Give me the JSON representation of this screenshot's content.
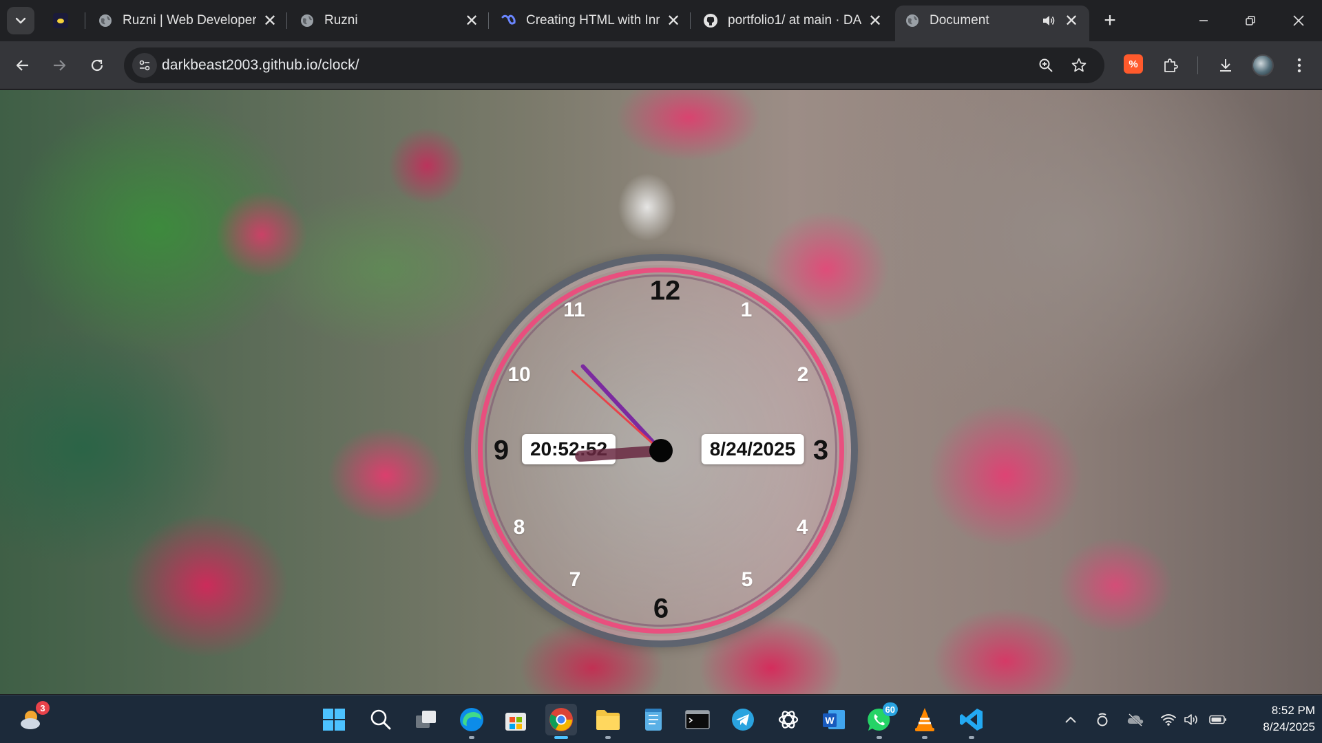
{
  "browser": {
    "pinned_tab_icon": "crescent-logo",
    "tabs": [
      {
        "title": "Ruzni | Web Developer",
        "icon": "globe-icon"
      },
      {
        "title": "Ruzni",
        "icon": "globe-icon"
      },
      {
        "title": "Creating HTML with Inn",
        "icon": "copilot-icon"
      },
      {
        "title": "portfolio1/ at main · DA",
        "icon": "github-icon"
      },
      {
        "title": "Document",
        "icon": "globe-icon",
        "active": true,
        "audio": true
      }
    ],
    "close_glyph": "✕",
    "new_tab_glyph": "+",
    "url": "darkbeast2003.github.io/clock/"
  },
  "clock": {
    "numerals": [
      "12",
      "1",
      "2",
      "3",
      "4",
      "5",
      "6",
      "7",
      "8",
      "9",
      "10",
      "11"
    ],
    "time_readout": "20:52:52",
    "date_readout": "8/24/2025",
    "hour": 20,
    "minute": 52,
    "second": 52,
    "colors": {
      "ring": "#ec4b7d",
      "minute_hand": "#7b2aa0",
      "second_hand": "#e8424a",
      "hour_hand": "#69284180"
    }
  },
  "taskbar": {
    "weather_badge": "3",
    "apps": [
      "windows-start-icon",
      "search-icon",
      "task-view-icon",
      "edge-icon",
      "store-icon",
      "chrome-icon",
      "file-explorer-icon",
      "notepad-icon",
      "terminal-icon",
      "telegram-icon",
      "chatgpt-icon",
      "word-icon",
      "whatsapp-icon",
      "vlc-icon",
      "vscode-icon"
    ],
    "whatsapp_badge": "60",
    "time": "8:52 PM",
    "date": "8/24/2025"
  }
}
